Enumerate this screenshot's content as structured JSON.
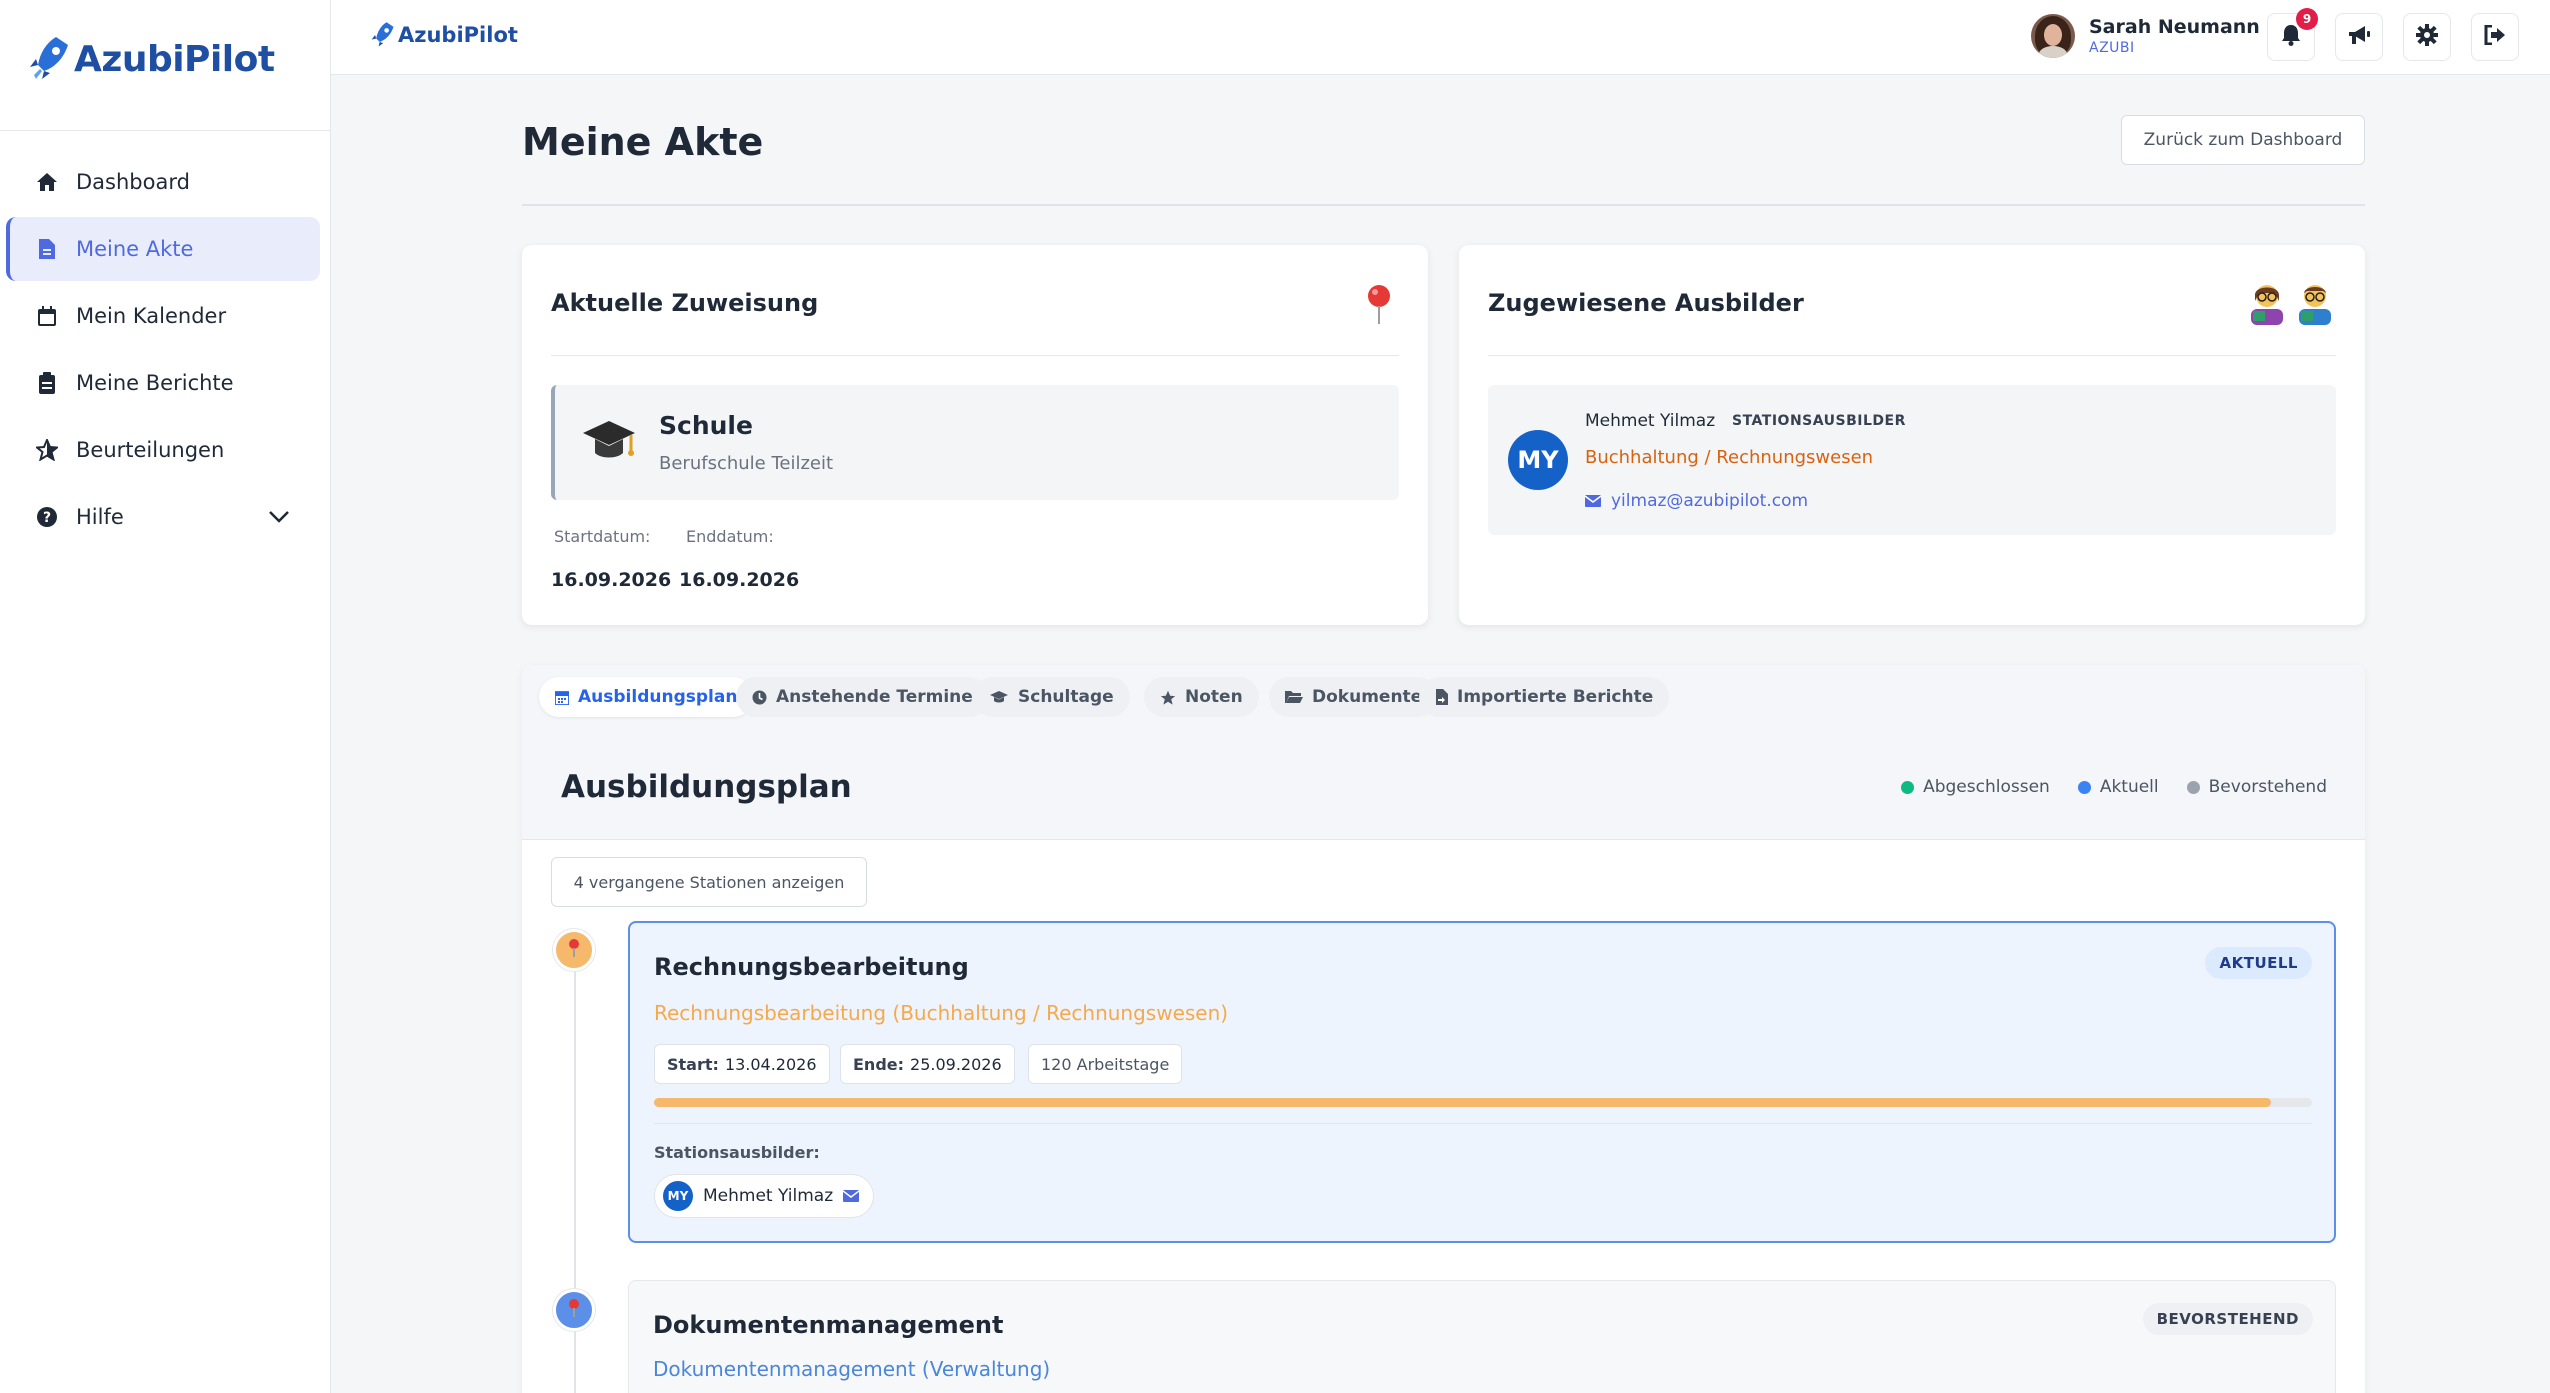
{
  "app": {
    "name": "AzubiPilot",
    "name_prefix": "Azubi",
    "name_suffix": "Pilot"
  },
  "sidebar": {
    "items": [
      {
        "label": "Dashboard",
        "icon": "home-icon"
      },
      {
        "label": "Meine Akte",
        "icon": "file-icon",
        "active": true
      },
      {
        "label": "Mein Kalender",
        "icon": "calendar-icon"
      },
      {
        "label": "Meine Berichte",
        "icon": "clipboard-icon"
      },
      {
        "label": "Beurteilungen",
        "icon": "star-icon"
      },
      {
        "label": "Hilfe",
        "icon": "help-icon"
      }
    ]
  },
  "header": {
    "user_name": "Sarah Neumann",
    "user_role": "AZUBI",
    "notification_count": "9"
  },
  "page": {
    "title": "Meine Akte",
    "back_label": "Zurück zum Dashboard"
  },
  "assignment": {
    "title": "Aktuelle Zuweisung",
    "type": "Schule",
    "detail": "Berufschule Teilzeit",
    "start_label": "Startdatum:",
    "end_label": "Enddatum:",
    "start": "16.09.2026",
    "end": "16.09.2026"
  },
  "instructors": {
    "title": "Zugewiesene Ausbilder",
    "initials": "MY",
    "name": "Mehmet Yilmaz",
    "role": "STATIONSAUSBILDER",
    "department": "Buchhaltung / Rechnungswesen",
    "email": "yilmaz@azubipilot.com"
  },
  "tabs": [
    {
      "label": "Ausbildungsplan",
      "icon": "calendar-icon",
      "active": true
    },
    {
      "label": "Anstehende Termine",
      "icon": "clock-icon"
    },
    {
      "label": "Schultage",
      "icon": "graduation-cap-icon"
    },
    {
      "label": "Noten",
      "icon": "star-icon"
    },
    {
      "label": "Dokumente",
      "icon": "folder-icon"
    },
    {
      "label": "Importierte Berichte",
      "icon": "file-import-icon"
    }
  ],
  "plan": {
    "title": "Ausbildungsplan",
    "legend": [
      {
        "label": "Abgeschlossen",
        "color": "#10b981"
      },
      {
        "label": "Aktuell",
        "color": "#3b82f6"
      },
      {
        "label": "Bevorstehend",
        "color": "#9ca3af"
      }
    ],
    "past_button": "4 vergangene Stationen anzeigen",
    "stations": [
      {
        "title": "Rechnungsbearbeitung",
        "badge": "AKTUELL",
        "subtitle": "Rechnungsbearbeitung (Buchhaltung / Rechnungswesen)",
        "start_label": "Start:",
        "start": "13.04.2026",
        "end_label": "Ende:",
        "end": "25.09.2026",
        "workdays": "120 Arbeitstage",
        "progress": 0.975,
        "trainer_label": "Stationsausbilder:",
        "trainer_initials": "MY",
        "trainer_name": "Mehmet Yilmaz"
      },
      {
        "title": "Dokumentenmanagement",
        "badge": "BEVORSTEHEND",
        "subtitle": "Dokumentenmanagement (Verwaltung)"
      }
    ]
  },
  "colors": {
    "accent": "#4f6ae0",
    "brand": "#1e4fa3",
    "current_marker": "#f6b86b",
    "upcoming_marker": "#5b8fe8",
    "orange_text": "#d9620f"
  }
}
